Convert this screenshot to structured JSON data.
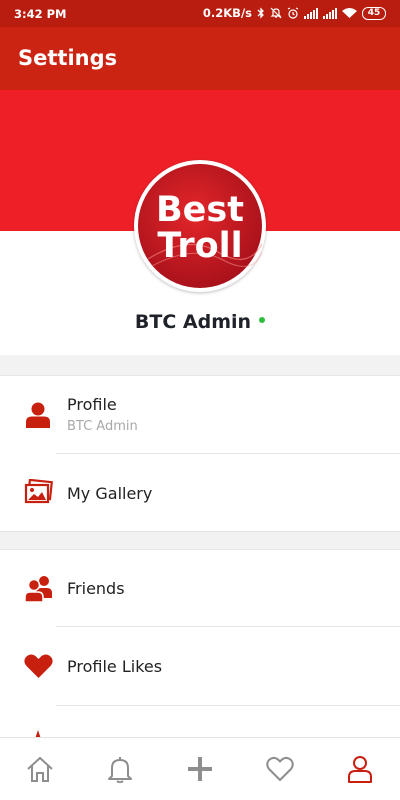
{
  "status_bar": {
    "time": "3:42 PM",
    "net_speed": "0.2KB/s",
    "battery": "45",
    "icons": [
      "bluetooth-icon",
      "mute-icon",
      "alarm-icon",
      "signal-icon",
      "signal-icon",
      "wifi-icon",
      "battery-icon"
    ]
  },
  "app_bar": {
    "title": "Settings"
  },
  "profile_header": {
    "avatar_text_line1": "Best",
    "avatar_text_line2": "Troll",
    "username": "BTC Admin",
    "status": "online"
  },
  "menu": {
    "profile": {
      "label": "Profile",
      "sublabel": "BTC Admin",
      "icon": "person-icon"
    },
    "gallery": {
      "label": "My Gallery",
      "icon": "gallery-icon"
    },
    "friends": {
      "label": "Friends",
      "icon": "friends-icon"
    },
    "likes": {
      "label": "Profile Likes",
      "icon": "heart-icon"
    }
  },
  "bottom_nav": {
    "items": [
      "home-icon",
      "bell-icon",
      "plus-icon",
      "heart-outline-icon",
      "user-icon"
    ],
    "active": "user-icon"
  },
  "colors": {
    "status_bar": "#b81d0f",
    "app_bar": "#cc2412",
    "header_band": "#ef1f28",
    "icon_red": "#c8200f",
    "online": "#2fbf3c",
    "nav_inactive": "#8e8e8e"
  }
}
